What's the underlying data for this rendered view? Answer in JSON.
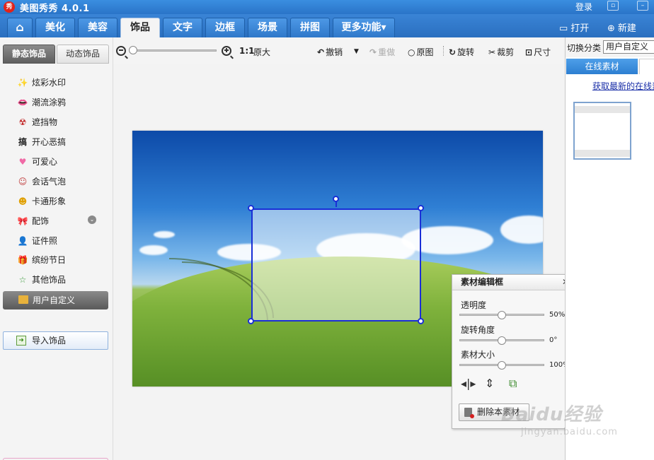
{
  "app": {
    "title": "美图秀秀 4.0.1",
    "logo_char": "秀",
    "login": "登录"
  },
  "tabs": [
    {
      "label": "美化"
    },
    {
      "label": "美容"
    },
    {
      "label": "饰品"
    },
    {
      "label": "文字"
    },
    {
      "label": "边框"
    },
    {
      "label": "场景"
    },
    {
      "label": "拼图"
    },
    {
      "label": "更多功能▾"
    }
  ],
  "active_tab": "饰品",
  "header_actions": {
    "open": "打开",
    "new": "新建"
  },
  "left_panel": {
    "subtabs": [
      "静态饰品",
      "动态饰品"
    ],
    "categories": [
      "炫彩水印",
      "潮流涂鸦",
      "遮挡物",
      "开心恶搞",
      "可爱心",
      "会话气泡",
      "卡通形象",
      "配饰",
      "证件照",
      "缤纷节日",
      "其他饰品"
    ],
    "category_icons": [
      "✨",
      "👄",
      "☢",
      "搞",
      "♥",
      "☺",
      "☻",
      "🎀",
      "👤",
      "🎁",
      "☆"
    ],
    "selected_category": "用户自定义",
    "import_button": "导入饰品"
  },
  "toolbar": {
    "ratio": "1:1",
    "original_size": "原大",
    "undo": "撤销",
    "redo": "重做",
    "original_image": "原图",
    "rotate": "旋转",
    "crop": "裁剪",
    "size": "尺寸"
  },
  "edit_panel": {
    "title": "素材编辑框",
    "opacity_label": "透明度",
    "opacity_value": "50%",
    "opacity": 0.5,
    "rotation_label": "旋转角度",
    "rotation_value": "0°",
    "size_label": "素材大小",
    "size_value": "100%",
    "delete_button": "删除本素材"
  },
  "right_panel": {
    "category_label": "切换分类",
    "category_value": "用户自定义",
    "tab_online": "在线素材",
    "link": "获取最新的在线素材"
  },
  "watermark": {
    "main": "Baidu经验",
    "sub": "jingyan.baidu.com"
  }
}
